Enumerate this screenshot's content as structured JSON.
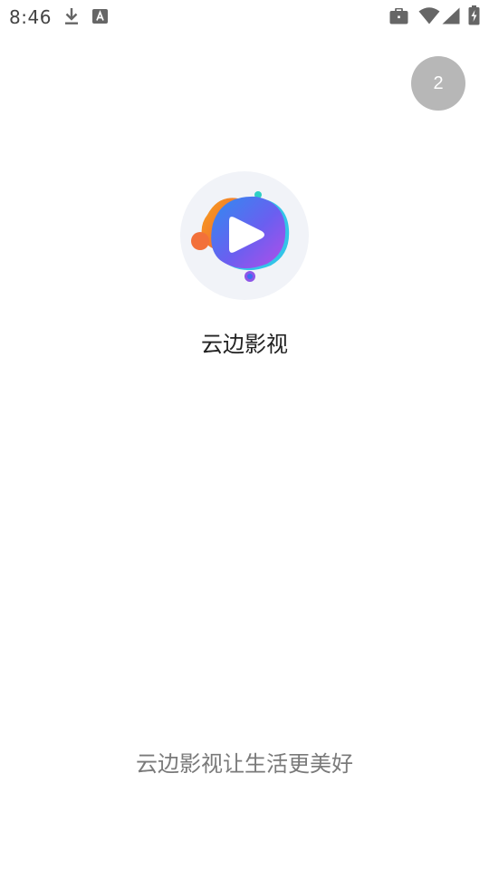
{
  "status_bar": {
    "time": "8:46",
    "icons": [
      "download-icon",
      "font-a-icon",
      "briefcase-icon",
      "wifi-icon",
      "signal-icon",
      "battery-charging-icon"
    ]
  },
  "countdown": {
    "value": "2"
  },
  "app": {
    "name": "云边影视",
    "slogan": "云边影视让生活更美好",
    "logo_icon": "play-logo-icon"
  },
  "colors": {
    "countdown_bg": "#b7b7b7",
    "logo_blue": "#3b82f6",
    "logo_purple": "#a855f7",
    "logo_orange": "#f59e0b"
  }
}
